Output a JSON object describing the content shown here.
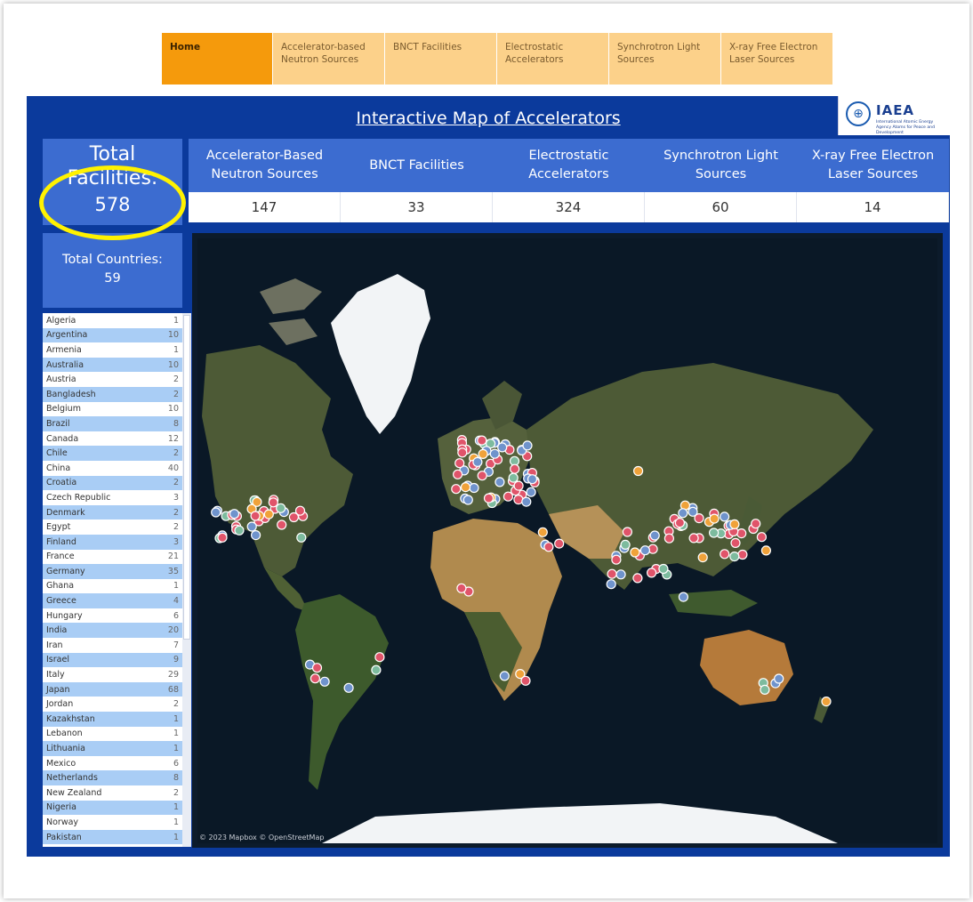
{
  "nav": {
    "tabs": [
      {
        "label": "Home",
        "active": true
      },
      {
        "label": "Accelerator-based Neutron Sources",
        "active": false
      },
      {
        "label": "BNCT Facilities",
        "active": false
      },
      {
        "label": "Electrostatic Accelerators",
        "active": false
      },
      {
        "label": "Synchrotron Light Sources",
        "active": false
      },
      {
        "label": "X-ray Free Electron Laser Sources",
        "active": false
      }
    ]
  },
  "header": {
    "title": "Interactive Map of Accelerators",
    "logo_text": "IAEA",
    "logo_sub": "International Atomic Energy Agency Atoms for Peace and Development"
  },
  "totals": {
    "facilities_label": "Total Facilities:",
    "facilities_value": "578",
    "countries_label": "Total Countries:",
    "countries_value": "59"
  },
  "categories": [
    {
      "label": "Accelerator-Based Neutron Sources",
      "value": "147"
    },
    {
      "label": "BNCT Facilities",
      "value": "33"
    },
    {
      "label": "Electrostatic Accelerators",
      "value": "324"
    },
    {
      "label": "Synchrotron Light Sources",
      "value": "60"
    },
    {
      "label": "X-ray Free Electron Laser Sources",
      "value": "14"
    }
  ],
  "countries": [
    {
      "name": "Algeria",
      "count": "1"
    },
    {
      "name": "Argentina",
      "count": "10"
    },
    {
      "name": "Armenia",
      "count": "1"
    },
    {
      "name": "Australia",
      "count": "10"
    },
    {
      "name": "Austria",
      "count": "2"
    },
    {
      "name": "Bangladesh",
      "count": "2"
    },
    {
      "name": "Belgium",
      "count": "10"
    },
    {
      "name": "Brazil",
      "count": "8"
    },
    {
      "name": "Canada",
      "count": "12"
    },
    {
      "name": "Chile",
      "count": "2"
    },
    {
      "name": "China",
      "count": "40"
    },
    {
      "name": "Croatia",
      "count": "2"
    },
    {
      "name": "Czech Republic",
      "count": "3"
    },
    {
      "name": "Denmark",
      "count": "2"
    },
    {
      "name": "Egypt",
      "count": "2"
    },
    {
      "name": "Finland",
      "count": "3"
    },
    {
      "name": "France",
      "count": "21"
    },
    {
      "name": "Germany",
      "count": "35"
    },
    {
      "name": "Ghana",
      "count": "1"
    },
    {
      "name": "Greece",
      "count": "4"
    },
    {
      "name": "Hungary",
      "count": "6"
    },
    {
      "name": "India",
      "count": "20"
    },
    {
      "name": "Iran",
      "count": "7"
    },
    {
      "name": "Israel",
      "count": "9"
    },
    {
      "name": "Italy",
      "count": "29"
    },
    {
      "name": "Japan",
      "count": "68"
    },
    {
      "name": "Jordan",
      "count": "2"
    },
    {
      "name": "Kazakhstan",
      "count": "1"
    },
    {
      "name": "Lebanon",
      "count": "1"
    },
    {
      "name": "Lithuania",
      "count": "1"
    },
    {
      "name": "Mexico",
      "count": "6"
    },
    {
      "name": "Netherlands",
      "count": "8"
    },
    {
      "name": "New Zealand",
      "count": "2"
    },
    {
      "name": "Nigeria",
      "count": "1"
    },
    {
      "name": "Norway",
      "count": "1"
    },
    {
      "name": "Pakistan",
      "count": "1"
    }
  ],
  "map": {
    "credit": "© 2023 Mapbox © OpenStreetMap",
    "colors": {
      "ocean": "#0a1826",
      "land": "#4d5a36",
      "desert": "#b08a4e",
      "ice": "#f2f4f6",
      "dot_red": "#e0546a",
      "dot_blue": "#6f93cc",
      "dot_orange": "#f0a23a",
      "dot_teal": "#7dbb9e"
    }
  },
  "colors": {
    "dashboard_bg": "#0b3a9c",
    "card_bg": "#3c6cd0",
    "nav_active": "#f59a0c",
    "nav_inactive": "#fcd18a",
    "highlight": "#fff200"
  }
}
